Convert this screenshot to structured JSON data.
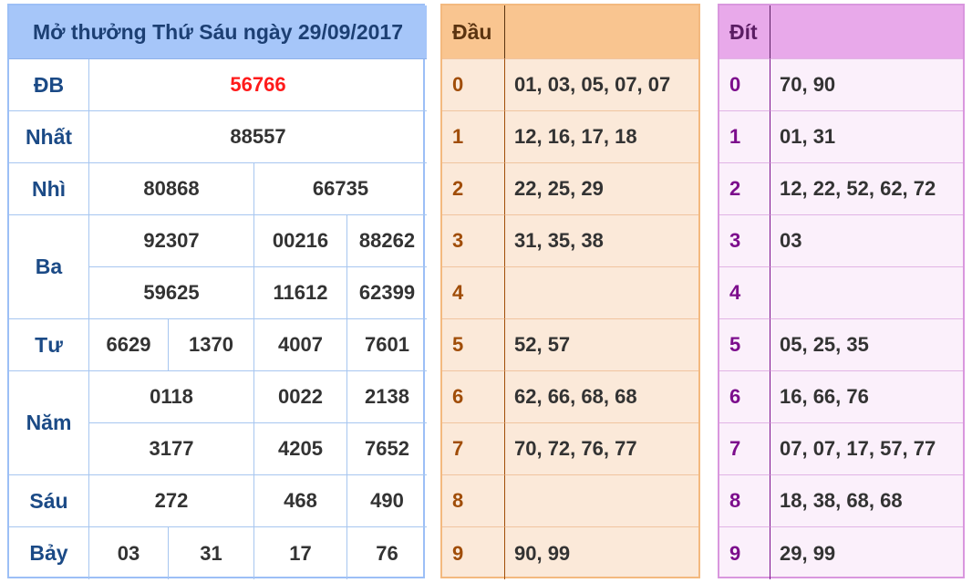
{
  "results": {
    "title": "Mở thưởng Thứ Sáu ngày 29/09/2017",
    "labels": {
      "db": "ĐB",
      "nhat": "Nhất",
      "nhi": "Nhì",
      "ba": "Ba",
      "tu": "Tư",
      "nam": "Năm",
      "sau": "Sáu",
      "bay": "Bảy"
    },
    "db": "56766",
    "nhat": "88557",
    "nhi": [
      "80868",
      "66735"
    ],
    "ba": [
      "92307",
      "00216",
      "88262",
      "59625",
      "11612",
      "62399"
    ],
    "tu": [
      "6629",
      "1370",
      "4007",
      "7601"
    ],
    "nam": [
      "0118",
      "0022",
      "2138",
      "3177",
      "4205",
      "7652"
    ],
    "sau": [
      "272",
      "468",
      "490"
    ],
    "bay": [
      "03",
      "31",
      "17",
      "76"
    ]
  },
  "dau": {
    "header": "Đầu",
    "rows": [
      {
        "digit": "0",
        "values": "01, 03, 05, 07, 07"
      },
      {
        "digit": "1",
        "values": "12, 16, 17, 18"
      },
      {
        "digit": "2",
        "values": "22, 25, 29"
      },
      {
        "digit": "3",
        "values": "31, 35, 38"
      },
      {
        "digit": "4",
        "values": ""
      },
      {
        "digit": "5",
        "values": "52, 57"
      },
      {
        "digit": "6",
        "values": "62, 66, 68, 68"
      },
      {
        "digit": "7",
        "values": "70, 72, 76, 77"
      },
      {
        "digit": "8",
        "values": ""
      },
      {
        "digit": "9",
        "values": "90, 99"
      }
    ]
  },
  "dit": {
    "header": "Đít",
    "rows": [
      {
        "digit": "0",
        "values": "70, 90"
      },
      {
        "digit": "1",
        "values": "01, 31"
      },
      {
        "digit": "2",
        "values": "12, 22, 52, 62, 72"
      },
      {
        "digit": "3",
        "values": "03"
      },
      {
        "digit": "4",
        "values": ""
      },
      {
        "digit": "5",
        "values": "05, 25, 35"
      },
      {
        "digit": "6",
        "values": "16, 66, 76"
      },
      {
        "digit": "7",
        "values": "07, 07, 17, 57, 77"
      },
      {
        "digit": "8",
        "values": "18, 38, 68, 68"
      },
      {
        "digit": "9",
        "values": "29, 99"
      }
    ]
  },
  "colors": {
    "results_header_bg": "#a6c6f9",
    "special_prize": "#ff1b1b",
    "dau_header_bg": "#f9c590",
    "dau_bg": "#fbe9d9",
    "dit_header_bg": "#e8a9ea",
    "dit_bg": "#fbf0fb"
  }
}
